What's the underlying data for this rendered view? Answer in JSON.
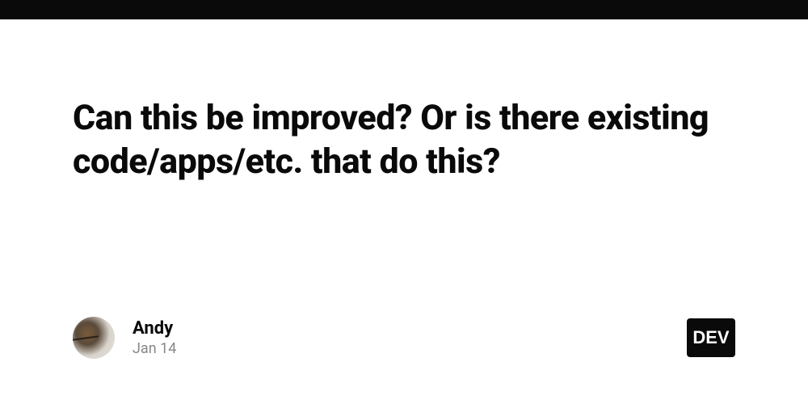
{
  "post": {
    "title": "Can this be improved? Or is there existing code/apps/etc. that do this?"
  },
  "author": {
    "name": "Andy",
    "date": "Jan 14"
  },
  "brand": {
    "badge": "DEV"
  }
}
